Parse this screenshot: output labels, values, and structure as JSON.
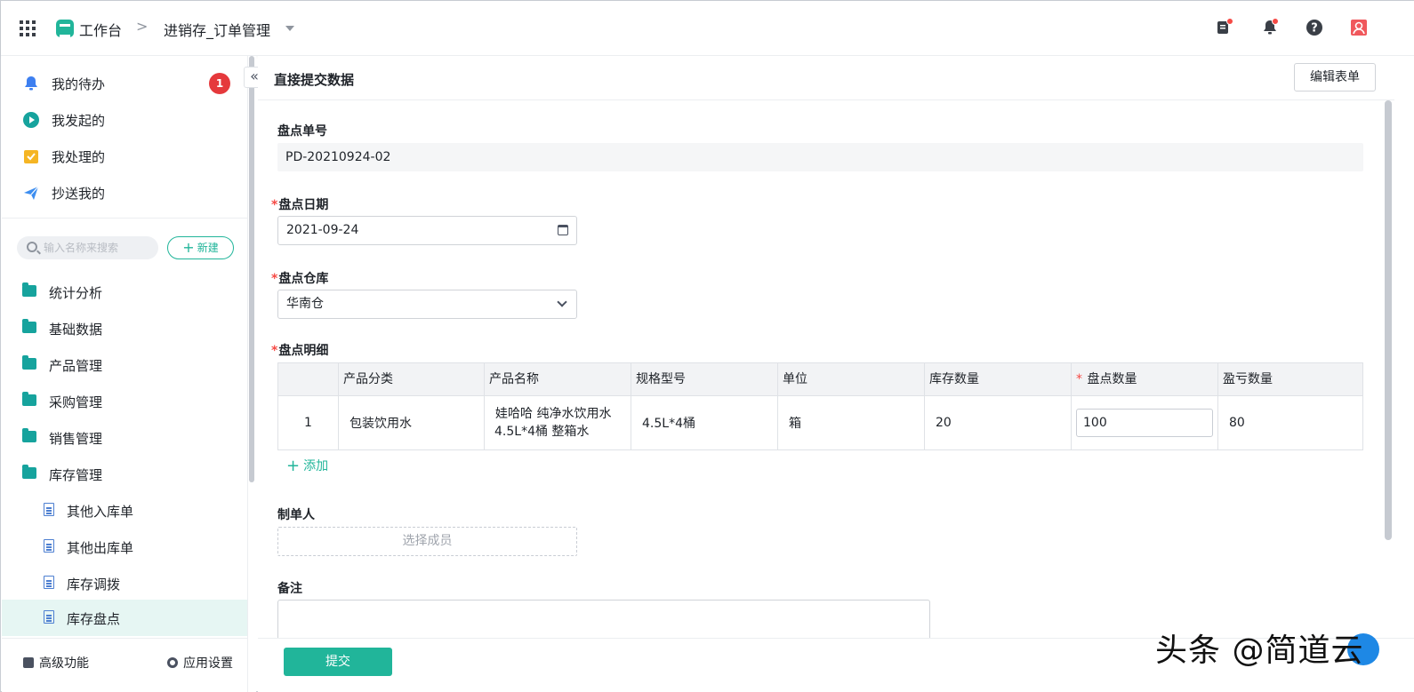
{
  "header": {
    "workbench": "工作台",
    "separator": ">",
    "app_name": "进销存_订单管理"
  },
  "sidebar": {
    "top_items": [
      {
        "label": "我的待办",
        "badge": "1"
      },
      {
        "label": "我发起的"
      },
      {
        "label": "我处理的"
      },
      {
        "label": "抄送我的"
      }
    ],
    "search_placeholder": "输入名称来搜索",
    "new_label": "新建",
    "folders": [
      "统计分析",
      "基础数据",
      "产品管理",
      "采购管理",
      "销售管理",
      "库存管理"
    ],
    "sub_items": [
      "其他入库单",
      "其他出库单",
      "库存调拨",
      "库存盘点"
    ],
    "active_sub": "库存盘点",
    "bottom": {
      "advanced": "高级功能",
      "settings": "应用设置"
    },
    "collapse": "«"
  },
  "main": {
    "title": "直接提交数据",
    "edit_form_label": "编辑表单",
    "fields": {
      "order_no": {
        "label": "盘点单号",
        "value": "PD-20210924-02"
      },
      "date": {
        "label": "盘点日期",
        "required": "*",
        "value": "2021-09-24"
      },
      "warehouse": {
        "label": "盘点仓库",
        "required": "*",
        "value": "华南仓"
      },
      "detail": {
        "label": "盘点明细",
        "required": "*"
      },
      "creator": {
        "label": "制单人",
        "placeholder": "选择成员"
      },
      "remark": {
        "label": "备注"
      }
    },
    "table": {
      "headers": [
        "产品分类",
        "产品名称",
        "规格型号",
        "单位",
        "库存数量",
        "盘点数量",
        "盈亏数量"
      ],
      "required_header_mark": "*",
      "rows": [
        {
          "index": "1",
          "category": "包装饮用水",
          "name_line1": "娃哈哈 纯净水饮用水",
          "name_line2": "4.5L*4桶 整箱水",
          "spec": "4.5L*4桶",
          "unit": "箱",
          "stock": "20",
          "count": "100",
          "diff": "80"
        }
      ],
      "add_label": "添加"
    },
    "submit_label": "提交"
  },
  "watermark": "头条 @简道云",
  "colors": {
    "accent": "#21b59a",
    "badge": "#e5393c",
    "required": "#f54a45"
  }
}
